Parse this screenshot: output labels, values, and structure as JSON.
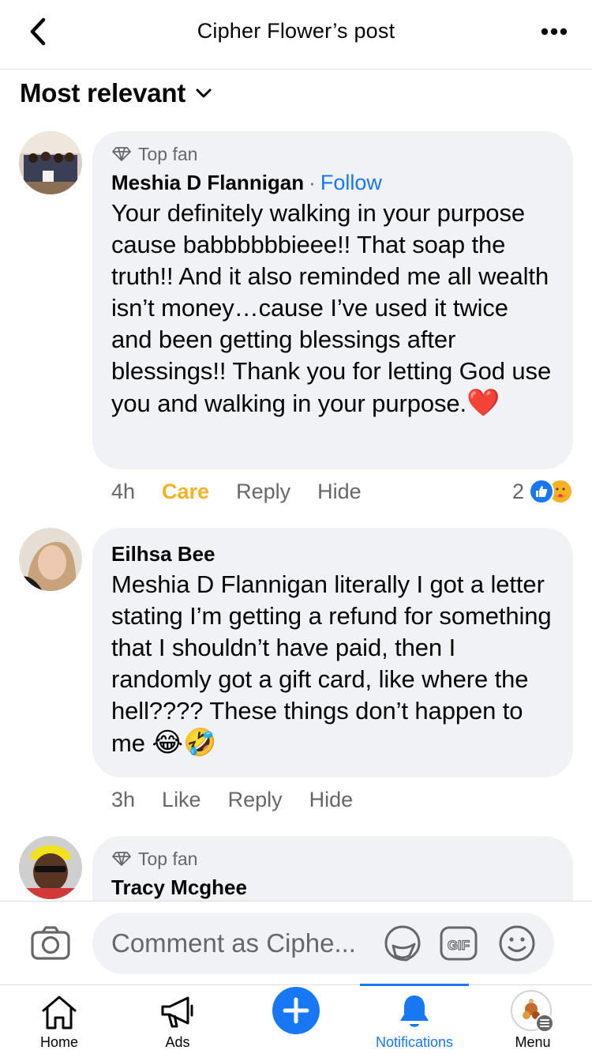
{
  "header": {
    "title": "Cipher Flower’s post"
  },
  "sort": {
    "label": "Most relevant"
  },
  "comments": [
    {
      "badge": "Top fan",
      "author": "Meshia D Flannigan",
      "follow_sep": "·",
      "follow_label": "Follow",
      "text": "Your definitely walking in your purpose cause babbbbbbieee!! That soap the truth!! And it also reminded me all wealth isn’t money…cause I’ve used it twice and been getting blessings after blessings!! Thank you for letting God use you and walking in your purpose.",
      "emoji": "❤️",
      "time": "4h",
      "reaction_label": "Care",
      "reply_label": "Reply",
      "hide_label": "Hide",
      "reaction_count": "2"
    },
    {
      "author": "Eilhsa Bee",
      "text": "Meshia D Flannigan literally I got a letter stating I’m getting a refund for something that I shouldn’t have paid, then I randomly got a gift card, like where the hell???? These things don’t happen to me",
      "emoji": "😂🤣",
      "time": "3h",
      "like_label": "Like",
      "reply_label": "Reply",
      "hide_label": "Hide"
    },
    {
      "badge": "Top fan",
      "author": "Tracy Mcghee"
    }
  ],
  "composer": {
    "placeholder": "Comment as Ciphe..."
  },
  "tabbar": {
    "items": [
      {
        "label": "Home",
        "icon": "home-icon"
      },
      {
        "label": "Ads",
        "icon": "megaphone-icon"
      },
      {
        "label": "",
        "icon": "plus-icon"
      },
      {
        "label": "Notifications",
        "icon": "bell-icon"
      },
      {
        "label": "Menu",
        "icon": "menu-avatar-icon"
      }
    ]
  },
  "colors": {
    "accent": "#1877f2",
    "care": "#f7b125",
    "bubble": "#f0f2f5",
    "muted": "#65676b"
  }
}
